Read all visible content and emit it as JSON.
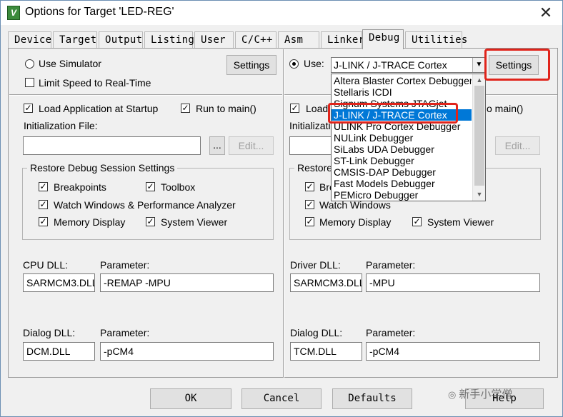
{
  "window": {
    "title": "Options for Target 'LED-REG'",
    "close_glyph": "✕",
    "icon_letter": "V"
  },
  "tabs": [
    "Device",
    "Target",
    "Output",
    "Listing",
    "User",
    "C/C++",
    "Asm",
    "Linker",
    "Debug",
    "Utilities"
  ],
  "active_tab": "Debug",
  "left": {
    "use_simulator": "Use Simulator",
    "settings": "Settings",
    "limit_speed": "Limit Speed to Real-Time",
    "load_app": "Load Application at Startup",
    "run_to_main": "Run to main()",
    "init_file_label": "Initialization File:",
    "init_file_value": "",
    "browse": "...",
    "edit": "Edit...",
    "restore_title": "Restore Debug Session Settings",
    "breakpoints": "Breakpoints",
    "toolbox": "Toolbox",
    "watch_windows": "Watch Windows & Performance Analyzer",
    "memory_display": "Memory Display",
    "system_viewer": "System Viewer",
    "cpu_dll_label": "CPU DLL:",
    "cpu_param_label": "Parameter:",
    "cpu_dll": "SARMCM3.DLL",
    "cpu_param": "-REMAP -MPU",
    "dialog_dll_label": "Dialog DLL:",
    "dialog_param_label": "Parameter:",
    "dialog_dll": "DCM.DLL",
    "dialog_param": "-pCM4"
  },
  "right": {
    "use_label": "Use:",
    "debugger_selected": "J-LINK / J-TRACE Cortex",
    "settings": "Settings",
    "load_app": "Load",
    "run_to_main": "o main()",
    "init_file_label": "Initializatio",
    "edit": "Edit...",
    "restore_title": "Restore",
    "breakpoints": "Bre",
    "watch_windows": "Watch Windows",
    "memory_display": "Memory Display",
    "system_viewer": "System Viewer",
    "driver_dll_label": "Driver DLL:",
    "driver_param_label": "Parameter:",
    "driver_dll": "SARMCM3.DLL",
    "driver_param": "-MPU",
    "dialog_dll_label": "Dialog DLL:",
    "dialog_param_label": "Parameter:",
    "dialog_dll": "TCM.DLL",
    "dialog_param": "-pCM4"
  },
  "dropdown_options": [
    "Altera Blaster Cortex Debugger",
    "Stellaris ICDI",
    "Signum Systems JTAGjet",
    "J-LINK / J-TRACE Cortex",
    "ULINK Pro Cortex Debugger",
    "NULink Debugger",
    "SiLabs UDA Debugger",
    "ST-Link Debugger",
    "CMSIS-DAP Debugger",
    "Fast Models Debugger",
    "PEMicro Debugger"
  ],
  "dropdown_selected_index": 3,
  "footer": {
    "ok": "OK",
    "cancel": "Cancel",
    "defaults": "Defaults",
    "help": "Help"
  },
  "watermark": "新手小学僧"
}
